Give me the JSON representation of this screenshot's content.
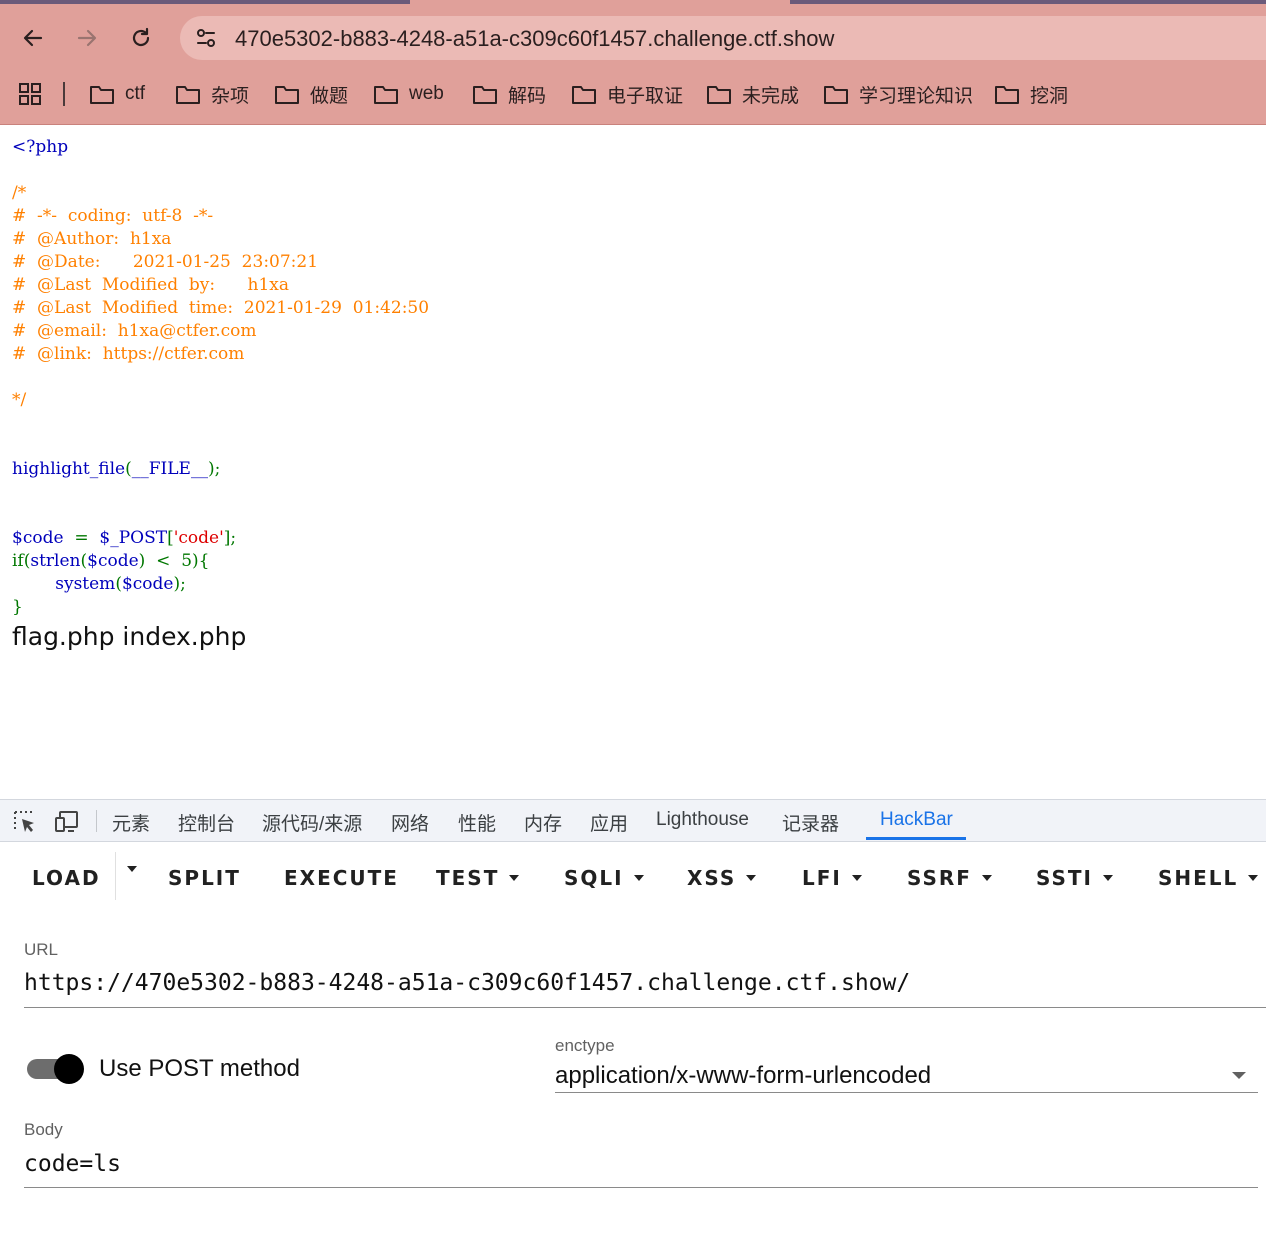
{
  "browser": {
    "url": "470e5302-b883-4248-a51a-c309c60f1457.challenge.ctf.show",
    "icons": [
      "back-arrow-icon",
      "forward-arrow-icon",
      "reload-icon",
      "site-info-icon",
      "apps-grid-icon",
      "folder-icon"
    ],
    "bookmarks": [
      "ctf",
      "杂项",
      "做题",
      "web",
      "解码",
      "电子取证",
      "未完成",
      "学习理论知识",
      "挖洞"
    ]
  },
  "page": {
    "code_lines": [
      "<?php",
      "",
      "/*",
      "#  -*-  coding:  utf-8  -*-",
      "#  @Author:  h1xa",
      "#  @Date:      2021-01-25  23:07:21",
      "#  @Last  Modified  by:      h1xa",
      "#  @Last  Modified  time:  2021-01-29  01:42:50",
      "#  @email:  h1xa@ctfer.com",
      "#  @link:  https://ctfer.com",
      "",
      "*/",
      "",
      "",
      "highlight_file(__FILE__);",
      "",
      "",
      "$code  =  $_POST['code'];",
      "if(strlen($code)  <  5){",
      "        system($code);",
      "}"
    ],
    "output": "flag.php index.php",
    "colors": {
      "default": "#0000BB",
      "comment": "#FF8000",
      "keyword": "#007700",
      "string": "#DD0000"
    }
  },
  "devtools": {
    "tabs": [
      "元素",
      "控制台",
      "源代码/来源",
      "网络",
      "性能",
      "内存",
      "应用",
      "Lighthouse",
      "记录器",
      "HackBar"
    ],
    "active_tab": "HackBar",
    "accent": "#1a73e8"
  },
  "hackbar": {
    "buttons": {
      "load": "LOAD",
      "split": "SPLIT",
      "execute": "EXECUTE",
      "test": "TEST",
      "sqli": "SQLI",
      "xss": "XSS",
      "lfi": "LFI",
      "ssrf": "SSRF",
      "ssti": "SSTI",
      "shell": "SHELL"
    },
    "url_label": "URL",
    "url_value": "https://470e5302-b883-4248-a51a-c309c60f1457.challenge.ctf.show/",
    "post_toggle_label": "Use POST method",
    "post_enabled": true,
    "enctype_label": "enctype",
    "enctype_value": "application/x-www-form-urlencoded",
    "body_label": "Body",
    "body_value": "code=ls"
  }
}
